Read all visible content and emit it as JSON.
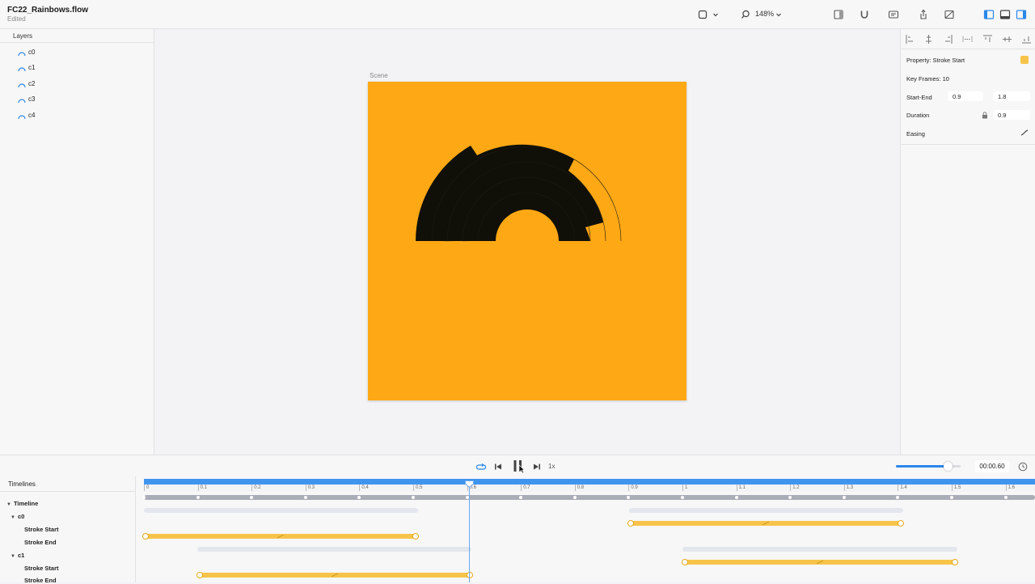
{
  "document": {
    "title": "FC22_Rainbows.flow",
    "status": "Edited"
  },
  "toolbar": {
    "zoom": "148%",
    "icons": [
      "shape-icon",
      "chevron-down-icon",
      "search-icon",
      "chevron-down-icon",
      "panel-icon",
      "magnet-icon",
      "comment-icon",
      "share-icon",
      "preview-icon",
      "left-panel-icon",
      "bottom-panel-icon",
      "right-panel-icon"
    ]
  },
  "layers": {
    "title": "Layers",
    "items": [
      {
        "label": "c0"
      },
      {
        "label": "c1"
      },
      {
        "label": "c2"
      },
      {
        "label": "c3"
      },
      {
        "label": "c4"
      }
    ]
  },
  "canvas": {
    "scene_label": "Scene",
    "background": "#ffa815",
    "shape_color": "#111008"
  },
  "inspector": {
    "property_label": "Property: Stroke Start",
    "property_color": "#f7c44a",
    "keyframes_label": "Key Frames: 10",
    "start_end_label": "Start-End",
    "start_value": "0.9",
    "end_value": "1.8",
    "duration_label": "Duration",
    "duration_value": "0.9",
    "easing_label": "Easing"
  },
  "transport": {
    "speed": "1x",
    "time": "00:00.60",
    "volume": 0.8
  },
  "timelines": {
    "title": "Timelines",
    "tree": [
      {
        "label": "Timeline",
        "level": 0,
        "expanded": true
      },
      {
        "label": "c0",
        "level": 1,
        "expanded": true
      },
      {
        "label": "Stroke Start",
        "level": 2
      },
      {
        "label": "Stroke End",
        "level": 2
      },
      {
        "label": "c1",
        "level": 1,
        "expanded": true
      },
      {
        "label": "Stroke Start",
        "level": 2
      },
      {
        "label": "Stroke End",
        "level": 2
      }
    ],
    "ruler_labels": [
      "0",
      "0.1",
      "0.2",
      "0.3",
      "0.4",
      "0.5",
      "0.6",
      "0.7",
      "0.8",
      "0.9",
      "1",
      "1.1",
      "1.2",
      "1.3",
      "1.4",
      "1.5",
      "1.6"
    ],
    "playhead_time": 0.6,
    "accent": "#3f95ee",
    "animation_color": "#f7c44a"
  }
}
